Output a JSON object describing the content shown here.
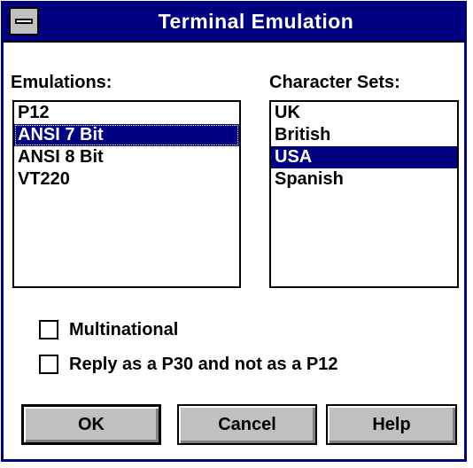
{
  "window": {
    "title": "Terminal Emulation"
  },
  "emulations": {
    "label": "Emulations:",
    "items": [
      "P12",
      "ANSI 7 Bit",
      "ANSI 8 Bit",
      "VT220"
    ],
    "selected": "ANSI 7 Bit"
  },
  "character_sets": {
    "label": "Character Sets:",
    "items": [
      "UK",
      "British",
      "USA",
      "Spanish"
    ],
    "selected": "USA"
  },
  "options": {
    "multinational": {
      "label": "Multinational",
      "checked": false
    },
    "reply_p30": {
      "label": "Reply as a P30 and not as a P12",
      "checked": false
    }
  },
  "buttons": {
    "ok": "OK",
    "cancel": "Cancel",
    "help": "Help"
  },
  "colors": {
    "title_bar": "#000080",
    "selection": "#000080",
    "button_face": "#c0c0c0"
  }
}
